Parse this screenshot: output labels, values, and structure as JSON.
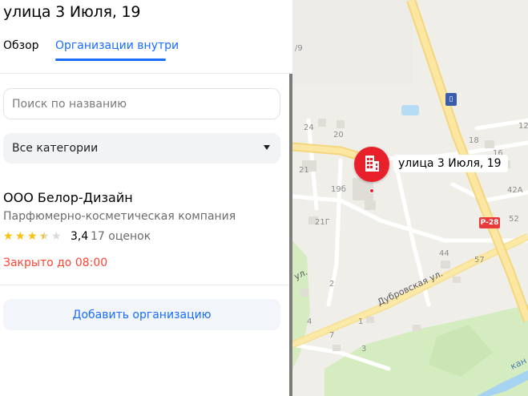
{
  "address_title": "улица 3 Июля, 19",
  "tabs": [
    {
      "label": "Обзор",
      "active": false
    },
    {
      "label": "Организации внутри",
      "active": true
    }
  ],
  "search": {
    "placeholder": "Поиск по названию",
    "value": ""
  },
  "category_select": {
    "selected": "Все категории"
  },
  "organization": {
    "name": "ООО Белор-Дизайн",
    "category": "Парфюмерно-косметическая компания",
    "rating": 3.4,
    "rating_text": "3,4",
    "reviews_text": "17 оценок",
    "status_text": "Закрыто до 08:00"
  },
  "add_button_label": "Добавить организацию",
  "colors": {
    "accent": "#196dff",
    "closed": "#ff4433",
    "star": "#fcc10f",
    "pin": "#e8202c"
  },
  "map": {
    "pin_label": "улица 3 Июля, 19",
    "street_label": "Дубровская ул.",
    "street_label_short": "ул.",
    "river_label": "кан",
    "road_shield": "Р-28",
    "building_numbers": [
      "/9",
      "24",
      "20",
      "21",
      "19б",
      "21Г",
      "2",
      "4",
      "7",
      "3",
      "1",
      "44",
      "57",
      "42А",
      "52",
      "18",
      "16",
      "12"
    ],
    "icons": [
      "building-pin-icon",
      "transport-icon"
    ]
  }
}
